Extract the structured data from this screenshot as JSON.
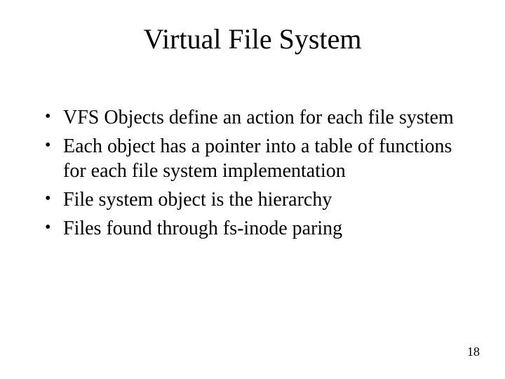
{
  "title": "Virtual File System",
  "bullets": [
    "VFS Objects define an action for each file system",
    "Each object has a pointer into a table of functions for each file system implementation",
    "File system object is the hierarchy",
    "Files found through fs-inode paring"
  ],
  "page_number": "18"
}
